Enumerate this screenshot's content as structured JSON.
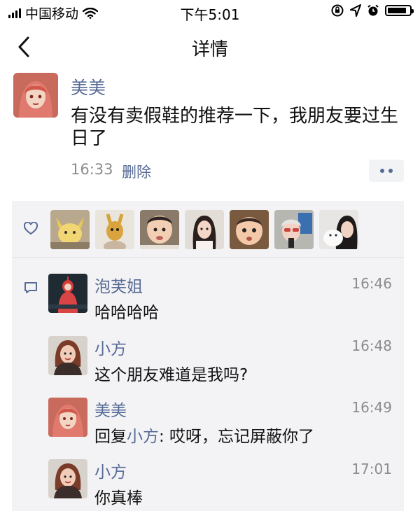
{
  "status_bar": {
    "carrier": "中国移动",
    "time": "下午5:01",
    "battery_level": 0.85
  },
  "nav": {
    "title": "详情",
    "back_icon": "chevron-left-icon"
  },
  "post": {
    "author": "美美",
    "content": "有没有卖假鞋的推荐一下，我朋友要过生日了",
    "time": "16:33",
    "delete_label": "删除",
    "more_icon": "more-dots-icon"
  },
  "likes": {
    "icon": "heart-icon",
    "count_avatars": 7
  },
  "comments": [
    {
      "name": "泡芙姐",
      "time": "16:46",
      "text": "哈哈哈哈"
    },
    {
      "name": "小方",
      "time": "16:48",
      "text": "这个朋友难道是我吗?"
    },
    {
      "name": "美美",
      "time": "16:49",
      "reply_prefix": "回复",
      "reply_to": "小方",
      "text": ": 哎呀，忘记屏蔽你了"
    },
    {
      "name": "小方",
      "time": "17:01",
      "text": "你真棒"
    }
  ],
  "colors": {
    "link": "#576b95",
    "panel_bg": "#f3f3f5",
    "meta_gray": "#8c8c8c"
  }
}
